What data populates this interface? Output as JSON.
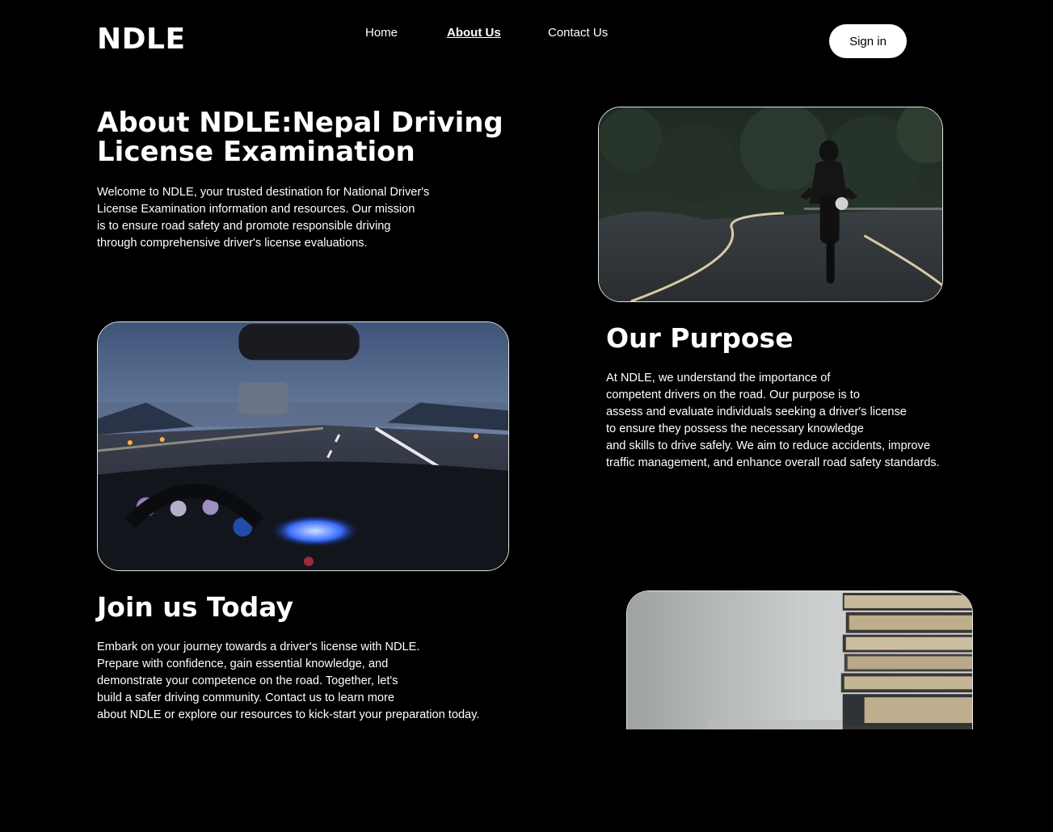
{
  "header": {
    "logo": "NDLE",
    "nav": [
      {
        "label": "Home"
      },
      {
        "label": "About Us"
      },
      {
        "label": "Contact Us"
      }
    ],
    "signin_label": "Sign in"
  },
  "about": {
    "title_line1": "About NDLE:Nepal Driving",
    "title_line2": "License Examination",
    "lines": [
      "Welcome to NDLE, your trusted destination for National Driver's",
      "License Examination information and resources. Our mission",
      "is to ensure road safety and promote responsible driving",
      "through comprehensive driver's license evaluations."
    ]
  },
  "purpose": {
    "title": "Our Purpose",
    "lines": [
      "At NDLE, we understand the importance of",
      "competent drivers on the road. Our purpose is to",
      "assess and evaluate individuals seeking a driver's license",
      "to ensure they possess the necessary knowledge",
      "and skills to drive safely. We aim to reduce accidents, improve",
      "traffic management, and enhance overall road safety standards."
    ]
  },
  "join": {
    "title": "Join us Today",
    "lines": [
      "Embark on your journey towards a driver's license with NDLE.",
      "Prepare with confidence, gain essential knowledge, and",
      "demonstrate your competence on the road. Together, let's",
      "build a safer driving community. Contact us to learn more",
      "about NDLE or explore our resources to kick-start your preparation today."
    ]
  },
  "colors": {
    "background": "#000000",
    "text": "#ffffff",
    "button_bg": "#ffffff",
    "button_text": "#000000"
  },
  "icons": [
    "motorcycle-road-image",
    "car-dashboard-road-image",
    "book-stack-image"
  ]
}
